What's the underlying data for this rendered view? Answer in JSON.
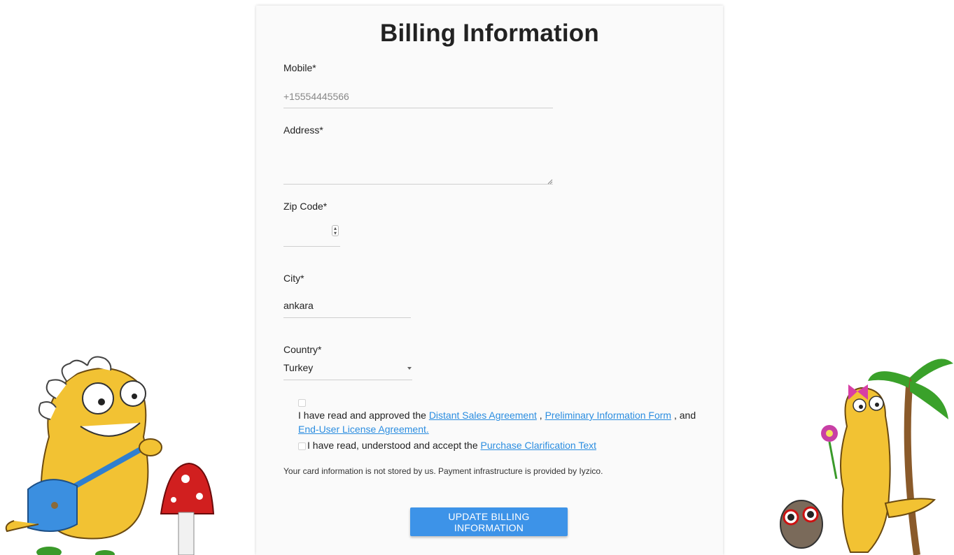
{
  "form": {
    "title": "Billing Information",
    "mobile": {
      "label": "Mobile*",
      "placeholder": "+15554445566"
    },
    "address": {
      "label": "Address*",
      "value": ""
    },
    "zip": {
      "label": "Zip Code*",
      "value": ""
    },
    "city": {
      "label": "City*",
      "value": "ankara"
    },
    "country": {
      "label": "Country*",
      "selected": "Turkey"
    },
    "agreement1": {
      "prefix": "I have read and approved the ",
      "link1": "Distant Sales Agreement",
      "sep1": " , ",
      "link2": "Preliminary Information Form",
      "sep2": " , and",
      "link3": "End-User License Agreement."
    },
    "agreement2": {
      "prefix": "I have read, understood and accept the ",
      "link": "Purchase Clarification Text"
    },
    "note": "Your card information is not stored by us. Payment infrastructure is provided by Iyzico.",
    "submit_label": "UPDATE BILLING INFORMATION"
  },
  "colors": {
    "accent": "#3d93e8",
    "link": "#2b8de0",
    "card": "#fafafa"
  }
}
